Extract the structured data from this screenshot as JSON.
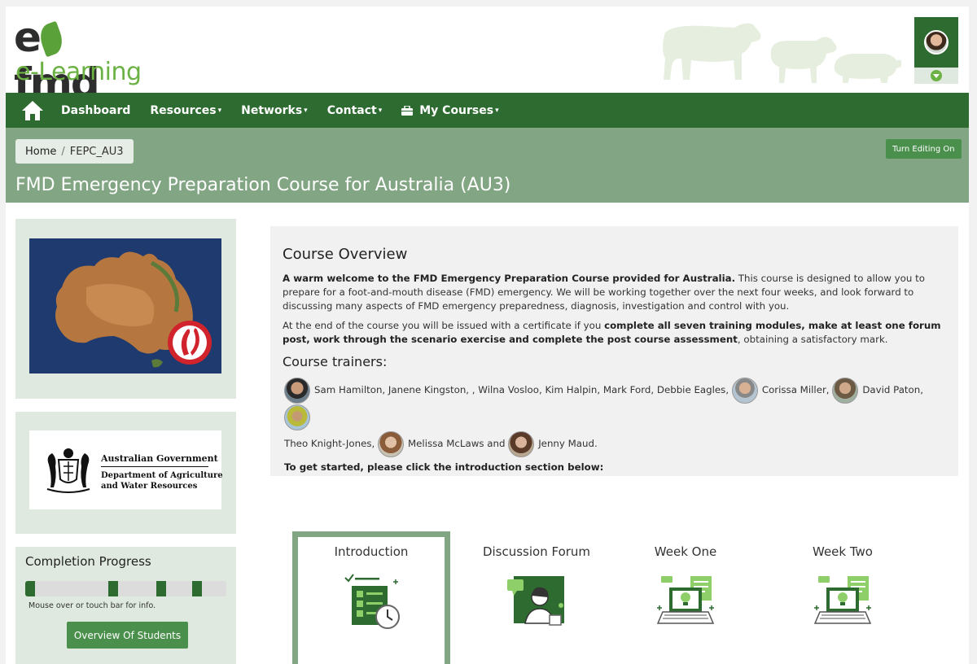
{
  "brand": {
    "logo_top": "e",
    "logo_top_rest": "fmd",
    "logo_bottom": "e-Learning"
  },
  "nav": {
    "items": [
      {
        "label": "Dashboard",
        "has_menu": false
      },
      {
        "label": "Resources",
        "has_menu": true
      },
      {
        "label": "Networks",
        "has_menu": true
      },
      {
        "label": "Contact",
        "has_menu": true
      },
      {
        "label": "My Courses",
        "has_menu": true
      }
    ],
    "caret": "▾"
  },
  "breadcrumb": {
    "home": "Home",
    "separator": "/",
    "current": "FEPC_AU3"
  },
  "edit_button": "Turn Editing On",
  "course_title": "FMD Emergency Preparation Course for Australia (AU3)",
  "government": {
    "line1": "Australian Government",
    "line2a": "Department of Agriculture",
    "line2b": "and Water Resources"
  },
  "progress": {
    "title": "Completion Progress",
    "hint": "Mouse over or touch bar for info.",
    "button": "Overview Of Students"
  },
  "overview": {
    "title": "Course Overview",
    "p1_bold": "A warm welcome to the FMD Emergency Preparation Course provided for Australia.",
    "p1_rest": " This course is designed to allow you to prepare for a foot-and-mouth disease (FMD) emergency. We will be working together over the next four weeks, and look forward to discussing many aspects of FMD emergency preparedness, diagnosis, investigation and control with you.",
    "p2_start": "At the end of the course you will be issued with a certificate if you ",
    "p2_bold": "complete all seven training modules, make at least one forum post, work through the scenario exercise and complete the post course assessment",
    "p2_end": ", obtaining a satisfactory mark.",
    "trainers_title": "Course trainers:",
    "trainers": {
      "t1": "Sam Hamilton, Janene Kingston, , Wilna Vosloo, Kim Halpin, Mark Ford, Debbie Eagles,",
      "t2": "Corissa Miller,",
      "t3": "David Paton,",
      "t4": "Theo Knight-Jones,",
      "t5": "Melissa McLaws and",
      "t6": "Jenny Maud."
    },
    "get_started": "To get started, please click the introduction section below:"
  },
  "sections": [
    {
      "label": "Introduction",
      "active": true
    },
    {
      "label": "Discussion Forum",
      "active": false
    },
    {
      "label": "Week One",
      "active": false
    },
    {
      "label": "Week Two",
      "active": false
    }
  ],
  "colors": {
    "nav_green": "#2e6b30",
    "band_green": "#82a584",
    "accent_green": "#6bb144",
    "button_green": "#4a8f4c"
  }
}
